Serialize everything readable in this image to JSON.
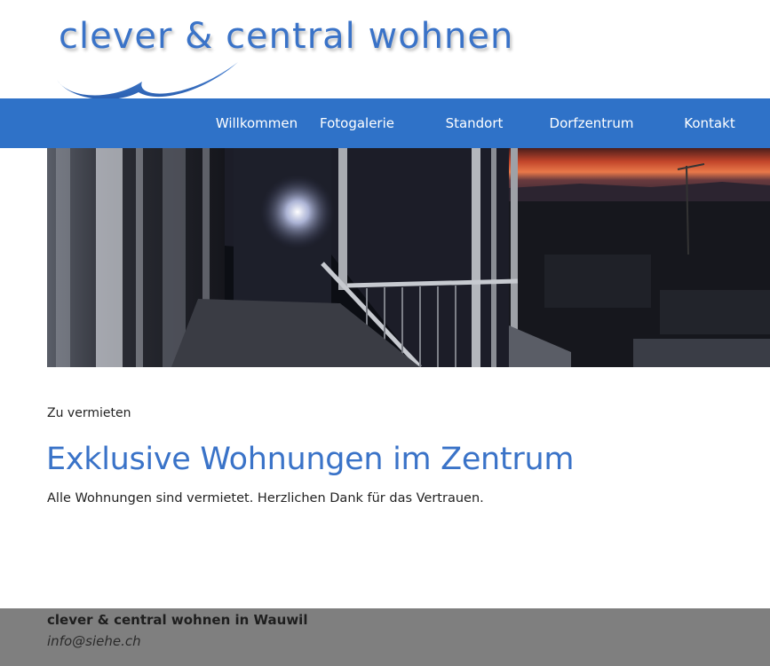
{
  "brand": {
    "logo_text": "clever & central wohnen",
    "accent_color": "#3a73c8",
    "nav_color": "#2f72c8"
  },
  "nav": {
    "items": [
      {
        "label": "Willkommen"
      },
      {
        "label": "Fotogalerie"
      },
      {
        "label": "Standort"
      },
      {
        "label": "Dorfzentrum"
      },
      {
        "label": "Kontakt"
      }
    ]
  },
  "hero": {
    "image": "balcony-sunset-photo"
  },
  "main": {
    "eyebrow": "Zu vermieten",
    "headline": "Exklusive Wohnungen im Zentrum",
    "body": "Alle Wohnungen sind vermietet. Herzlichen Dank für das Vertrauen."
  },
  "footer": {
    "title": "clever & central wohnen in Wauwil",
    "email": "info@siehe.ch",
    "background": "#7f7f7f"
  }
}
